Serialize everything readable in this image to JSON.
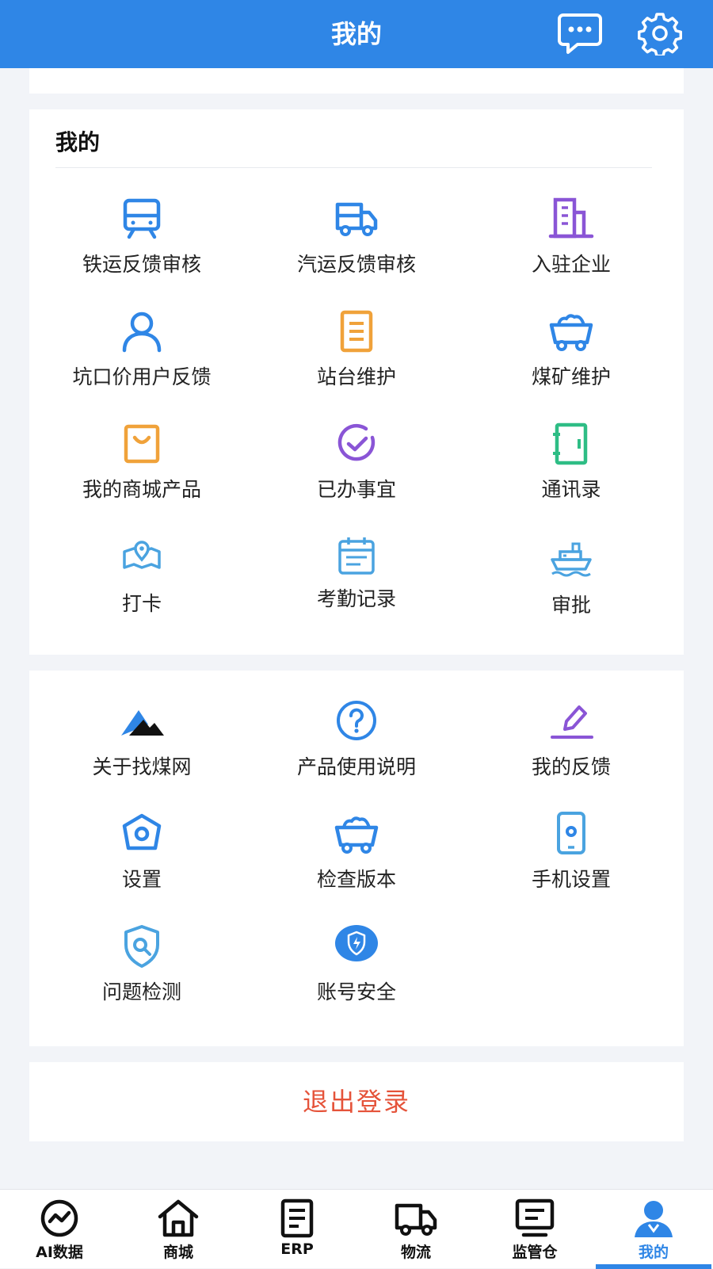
{
  "header": {
    "title": "我的"
  },
  "section": {
    "title": "我的"
  },
  "main_items": [
    {
      "label": "铁运反馈审核",
      "icon": "train-icon"
    },
    {
      "label": "汽运反馈审核",
      "icon": "truck-icon"
    },
    {
      "label": "入驻企业",
      "icon": "building-icon"
    },
    {
      "label": "坑口价用户反馈",
      "icon": "user-icon"
    },
    {
      "label": "站台维护",
      "icon": "document-icon"
    },
    {
      "label": "煤矿维护",
      "icon": "coal-cart-icon"
    },
    {
      "label": "我的商城产品",
      "icon": "shopping-bag-icon"
    },
    {
      "label": "已办事宜",
      "icon": "check-circle-icon"
    },
    {
      "label": "通讯录",
      "icon": "contact-book-icon"
    },
    {
      "label": "打卡",
      "icon": "location-map-icon"
    },
    {
      "label": "考勤记录",
      "icon": "calendar-icon"
    },
    {
      "label": "审批",
      "icon": "ship-icon"
    }
  ],
  "more_items": [
    {
      "label": "关于找煤网",
      "icon": "mountain-logo-icon"
    },
    {
      "label": "产品使用说明",
      "icon": "question-circle-icon"
    },
    {
      "label": "我的反馈",
      "icon": "pen-icon"
    },
    {
      "label": "设置",
      "icon": "hexagon-gear-icon"
    },
    {
      "label": "检查版本",
      "icon": "coal-cart-icon"
    },
    {
      "label": "手机设置",
      "icon": "phone-settings-icon"
    },
    {
      "label": "问题检测",
      "icon": "shield-search-icon"
    },
    {
      "label": "账号安全",
      "icon": "shield-bolt-icon"
    }
  ],
  "logout": {
    "label": "退出登录"
  },
  "tabs": [
    {
      "label": "AI数据",
      "icon": "trend-circle-icon"
    },
    {
      "label": "商城",
      "icon": "home-icon"
    },
    {
      "label": "ERP",
      "icon": "document-list-icon"
    },
    {
      "label": "物流",
      "icon": "truck-icon"
    },
    {
      "label": "监管仓",
      "icon": "monitor-icon"
    },
    {
      "label": "我的",
      "icon": "user-filled-icon"
    }
  ],
  "active_tab": "我的",
  "colors": {
    "primary": "#2f86e6",
    "logout": "#e5533a",
    "orange": "#f0a23a",
    "purple": "#8a55d6",
    "green": "#2ebd85",
    "light_blue": "#4aa3e0"
  }
}
